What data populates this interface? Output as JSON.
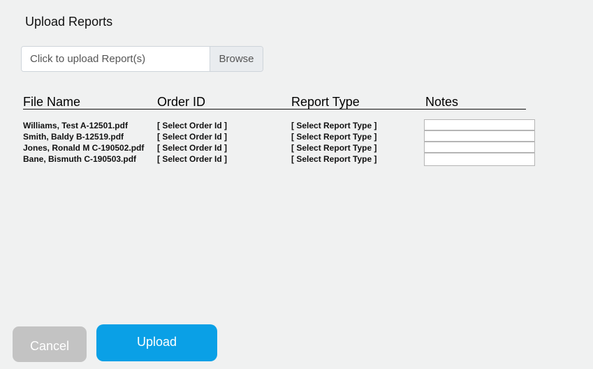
{
  "dialog": {
    "title": "Upload Reports"
  },
  "upload": {
    "placeholder": "Click to upload Report(s)",
    "browse_label": "Browse"
  },
  "table": {
    "headers": {
      "file_name": "File Name",
      "order_id": "Order ID",
      "report_type": "Report Type",
      "notes": "Notes"
    },
    "rows": [
      {
        "file_name": "Williams, Test A-12501.pdf",
        "order_id": "[ Select Order Id ]",
        "report_type": "[ Select Report Type ]",
        "notes": ""
      },
      {
        "file_name": "Smith, Baldy B-12519.pdf",
        "order_id": "[ Select Order Id ]",
        "report_type": "[ Select Report Type ]",
        "notes": ""
      },
      {
        "file_name": "Jones, Ronald M C-190502.pdf",
        "order_id": "[ Select Order Id ]",
        "report_type": "[ Select Report Type ]",
        "notes": ""
      },
      {
        "file_name": "Bane, Bismuth C-190503.pdf",
        "order_id": "[ Select Order Id ]",
        "report_type": "[ Select Report Type ]",
        "notes": ""
      }
    ]
  },
  "actions": {
    "cancel_label": "Cancel",
    "upload_label": "Upload"
  },
  "colors": {
    "background": "#f0f1f1",
    "upload_button": "#0aa0e6",
    "cancel_button": "#c3c3c3"
  }
}
